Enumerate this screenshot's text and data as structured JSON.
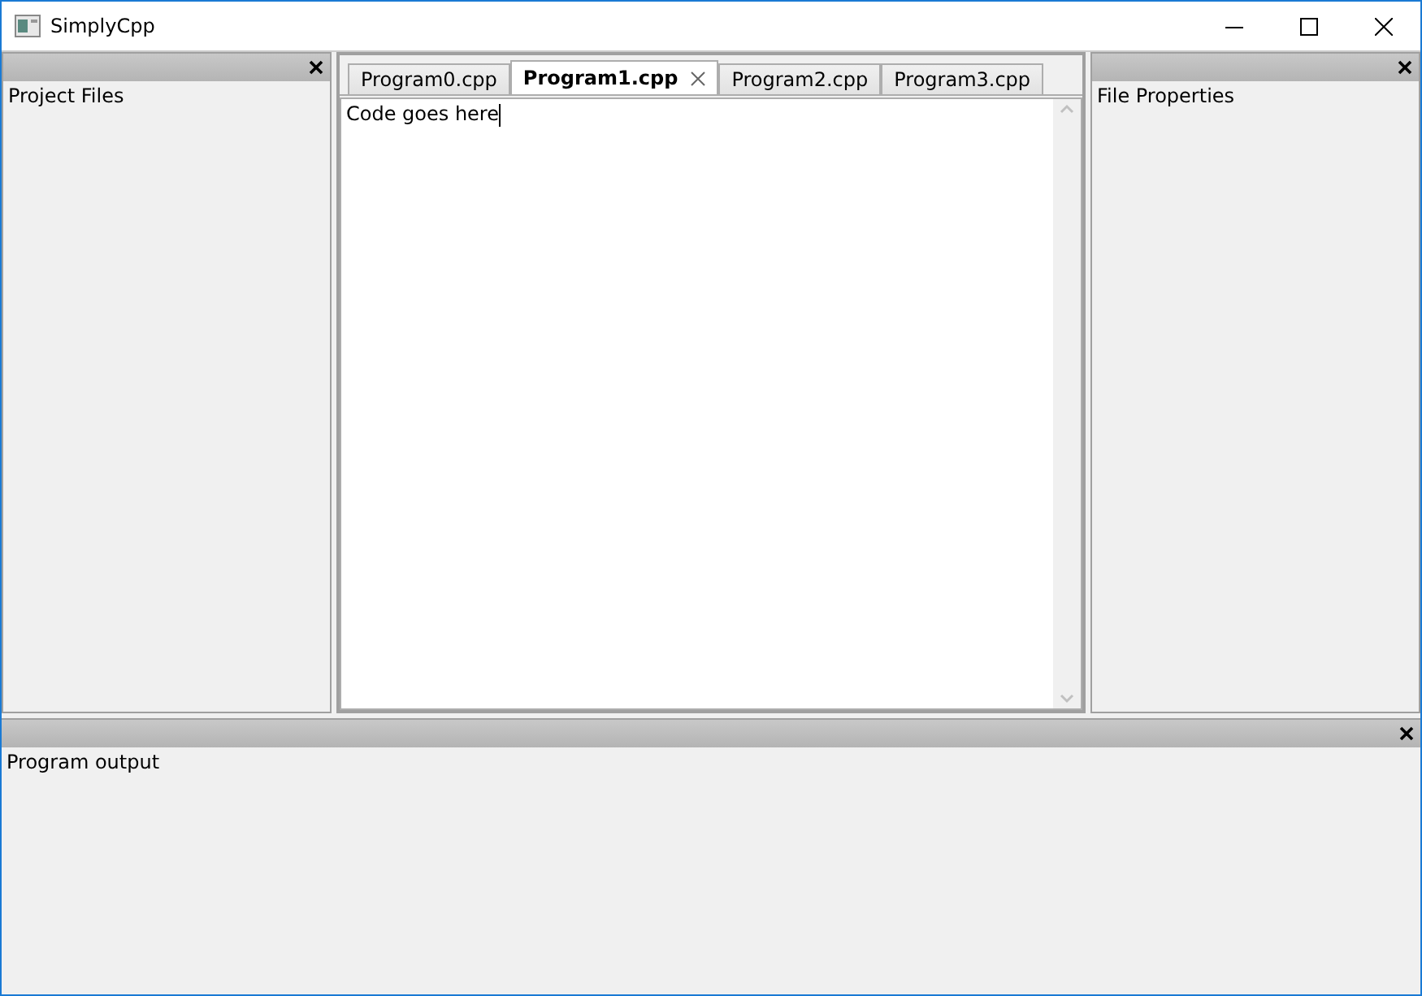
{
  "window": {
    "title": "SimplyCpp"
  },
  "left_panel": {
    "title": "Project Files"
  },
  "editor": {
    "tabs": [
      {
        "label": "Program0.cpp",
        "selected": false
      },
      {
        "label": "Program1.cpp",
        "selected": true
      },
      {
        "label": "Program2.cpp",
        "selected": false
      },
      {
        "label": "Program3.cpp",
        "selected": false
      }
    ],
    "content": "Code goes here"
  },
  "right_panel": {
    "title": "File Properties"
  },
  "bottom_panel": {
    "title": "Program output"
  }
}
